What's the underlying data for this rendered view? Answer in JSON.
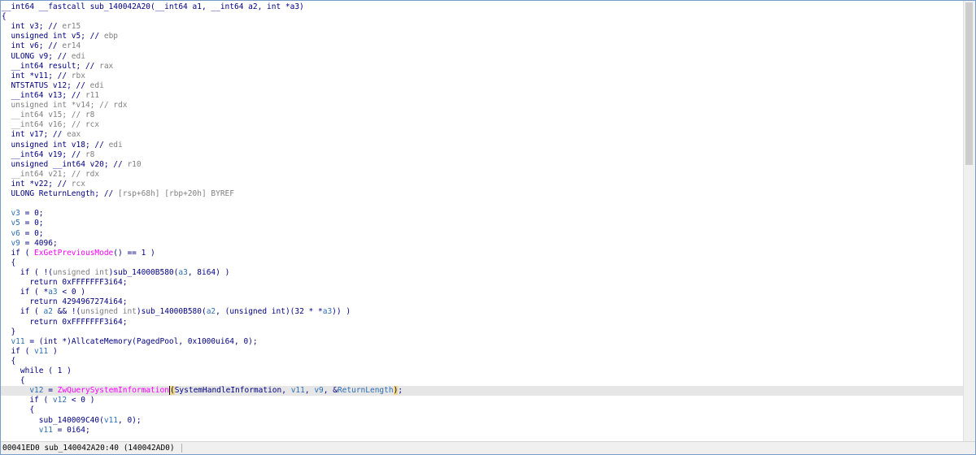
{
  "code_lines": [
    {
      "t": "__int64 __fastcall sub_140042A20(__int64 a1, __int64 a2, int *a3)",
      "cls": "k"
    },
    {
      "t": "{",
      "cls": "k"
    },
    {
      "t": "  int v3; // ",
      "cls": "k",
      "c": "er15"
    },
    {
      "t": "  unsigned int v5; // ",
      "cls": "k",
      "c": "ebp"
    },
    {
      "t": "  int v6; // ",
      "cls": "k",
      "c": "er14"
    },
    {
      "t": "  ULONG v9; // ",
      "cls": "k",
      "c": "edi"
    },
    {
      "t": "  __int64 result; // ",
      "cls": "k",
      "c": "rax"
    },
    {
      "t": "  int *v11; // ",
      "cls": "k",
      "c": "rbx"
    },
    {
      "t": "  NTSTATUS v12; // ",
      "cls": "k",
      "c": "edi"
    },
    {
      "t": "  __int64 v13; // ",
      "cls": "k",
      "c": "r11"
    },
    {
      "t": "  unsigned int *v14; // ",
      "cls": "g",
      "c": "rdx"
    },
    {
      "t": "  __int64 v15; // ",
      "cls": "g",
      "c": "r8"
    },
    {
      "t": "  __int64 v16; // ",
      "cls": "g",
      "c": "rcx"
    },
    {
      "t": "  int v17; // ",
      "cls": "k",
      "c": "eax"
    },
    {
      "t": "  unsigned int v18; // ",
      "cls": "k",
      "c": "edi"
    },
    {
      "t": "  __int64 v19; // ",
      "cls": "k",
      "c": "r8"
    },
    {
      "t": "  unsigned __int64 v20; // ",
      "cls": "k",
      "c": "r10"
    },
    {
      "t": "  __int64 v21; // ",
      "cls": "g",
      "c": "rdx"
    },
    {
      "t": "  int *v22; // ",
      "cls": "k",
      "c": "rcx"
    },
    {
      "t": "  ULONG ReturnLength; // ",
      "cls": "k",
      "c": "[rsp+68h] [rbp+20h] BYREF"
    },
    {
      "t": "",
      "cls": "k"
    },
    {
      "t": "  v3 = 0;",
      "cls": "mix",
      "parts": [
        [
          "  ",
          "k"
        ],
        [
          "v3",
          "var"
        ],
        [
          " = 0;",
          "k"
        ]
      ]
    },
    {
      "t": "  v5 = 0;",
      "cls": "mix",
      "parts": [
        [
          "  ",
          "k"
        ],
        [
          "v5",
          "var"
        ],
        [
          " = 0;",
          "k"
        ]
      ]
    },
    {
      "t": "  v6 = 0;",
      "cls": "mix",
      "parts": [
        [
          "  ",
          "k"
        ],
        [
          "v6",
          "var"
        ],
        [
          " = 0;",
          "k"
        ]
      ]
    },
    {
      "t": "  v9 = 4096;",
      "cls": "mix",
      "parts": [
        [
          "  ",
          "k"
        ],
        [
          "v9",
          "var"
        ],
        [
          " = 4096;",
          "k"
        ]
      ]
    },
    {
      "t": "  if ( ExGetPreviousMode() == 1 )",
      "cls": "mix",
      "parts": [
        [
          "  if ( ",
          "k"
        ],
        [
          "ExGetPreviousMode",
          "f"
        ],
        [
          "() == 1 )",
          "k"
        ]
      ]
    },
    {
      "t": "  {",
      "cls": "k"
    },
    {
      "t": "    if ( !(unsigned int)sub_14000B580(a3, 8i64) )",
      "cls": "mix",
      "parts": [
        [
          "    if ( !(",
          "k"
        ],
        [
          "unsigned int",
          "g"
        ],
        [
          ")sub_14000B580(",
          "k"
        ],
        [
          "a3",
          "var"
        ],
        [
          ", 8i64) )",
          "k"
        ]
      ]
    },
    {
      "t": "      return 0xFFFFFFF3i64;",
      "cls": "k"
    },
    {
      "t": "    if ( *a3 < 0 )",
      "cls": "mix",
      "parts": [
        [
          "    if ( *",
          "k"
        ],
        [
          "a3",
          "var"
        ],
        [
          " < 0 )",
          "k"
        ]
      ]
    },
    {
      "t": "      return 4294967274i64;",
      "cls": "k"
    },
    {
      "t": "    if ( a2 && !(unsigned int)sub_14000B580(a2, (unsigned int)(32 * *a3)) )",
      "cls": "mix",
      "parts": [
        [
          "    if ( ",
          "k"
        ],
        [
          "a2",
          "var"
        ],
        [
          " && !(",
          "k"
        ],
        [
          "unsigned int",
          "g"
        ],
        [
          ")sub_14000B580(",
          "k"
        ],
        [
          "a2",
          "var"
        ],
        [
          ", (unsigned int)(32 * *",
          "k"
        ],
        [
          "a3",
          "var"
        ],
        [
          ")) )",
          "k"
        ]
      ]
    },
    {
      "t": "      return 0xFFFFFFF3i64;",
      "cls": "k"
    },
    {
      "t": "  }",
      "cls": "k"
    },
    {
      "t": "  v11 = (int *)AllcateMemory(PagedPool, 0x1000ui64, 0);",
      "cls": "mix",
      "parts": [
        [
          "  ",
          "k"
        ],
        [
          "v11",
          "var"
        ],
        [
          " = (int *)AllcateMemory(PagedPool, 0x1000ui64, 0);",
          "k"
        ]
      ]
    },
    {
      "t": "  if ( v11 )",
      "cls": "mix",
      "parts": [
        [
          "  if ( ",
          "k"
        ],
        [
          "v11",
          "var"
        ],
        [
          " )",
          "k"
        ]
      ]
    },
    {
      "t": "  {",
      "cls": "k"
    },
    {
      "t": "    while ( 1 )",
      "cls": "k"
    },
    {
      "t": "    {",
      "cls": "k"
    },
    {
      "t": "      v12 = ZwQuerySystemInformation(SystemHandleInformation, v11, v9, &ReturnLength);",
      "cls": "hl"
    },
    {
      "t": "      if ( v12 < 0 )",
      "cls": "mix",
      "parts": [
        [
          "      if ( ",
          "k"
        ],
        [
          "v12",
          "var"
        ],
        [
          " < 0 )",
          "k"
        ]
      ]
    },
    {
      "t": "      {",
      "cls": "k"
    },
    {
      "t": "        sub_140009C40(v11, 0);",
      "cls": "mix",
      "parts": [
        [
          "        sub_140009C40(",
          "k"
        ],
        [
          "v11",
          "var"
        ],
        [
          ", 0);",
          "k"
        ]
      ]
    },
    {
      "t": "        v11 = 0i64;",
      "cls": "mix",
      "parts": [
        [
          "        ",
          "k"
        ],
        [
          "v11",
          "var"
        ],
        [
          " = 0i64;",
          "k"
        ]
      ]
    }
  ],
  "status": {
    "text": "00041ED0 sub_140042A20:40 (140042AD0)"
  }
}
